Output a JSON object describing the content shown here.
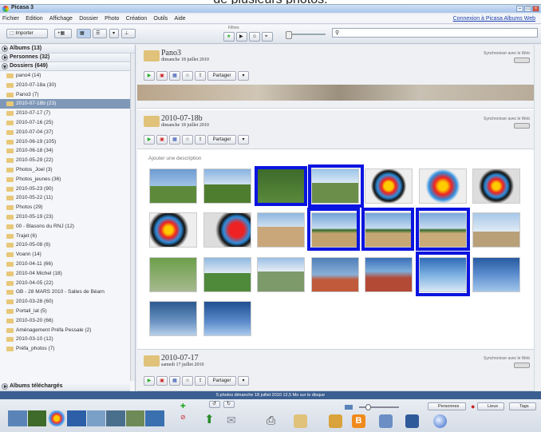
{
  "caption": "de plusieurs photos.",
  "window": {
    "title": "Picasa 3"
  },
  "menu": {
    "items": [
      "Fichier",
      "Edition",
      "Affichage",
      "Dossier",
      "Photo",
      "Création",
      "Outils",
      "Aide"
    ],
    "account_link": "Connexion à Picasa Albums Web"
  },
  "toolbar": {
    "import_label": "Importer",
    "filter_title": "Filtres"
  },
  "sidebar": {
    "albums": "Albums (13)",
    "people": "Personnes (32)",
    "folders": "Dossiers (649)",
    "folder_items": [
      "pano4 (14)",
      "2010-07-18a (30)",
      "Pano3 (7)",
      "2010-07-18b (23)",
      "2010-07-17 (7)",
      "2010-07-16 (25)",
      "2010-07-04 (37)",
      "2010-06-19 (105)",
      "2010-06-18 (34)",
      "2010-05-29 (22)",
      "Photos_Joel (3)",
      "Photos_jeunes (36)",
      "2010-05-23 (90)",
      "2010-05-22 (11)",
      "Photos (29)",
      "2010-05-19 (23)",
      "00 - Blasons du RNJ (12)",
      "Trajet (6)",
      "2010-05-08 (6)",
      "Voann (14)",
      "2010-04-11 (66)",
      "2010-04 Michel (18)",
      "2010-04-05 (22)",
      "GB - 28 MARS 2010 - Salies de Béarn",
      "2010-03-28 (60)",
      "Portail_lat (5)",
      "2010-03-20 (66)",
      "Aménagement Préfa Pessale (2)",
      "2010-03-10 (12)",
      "Préfa_photos (7)"
    ],
    "selected_index": 3,
    "downloaded": "Albums téléchargés"
  },
  "folders": [
    {
      "name": "Pano3",
      "date": "dimanche 18 juillet 2010",
      "sync": "Synchroniser avec le Web",
      "share": "Partager"
    },
    {
      "name": "2010-07-18b",
      "date": "dimanche 18 juillet 2010",
      "sync": "Synchroniser avec le Web",
      "share": "Partager",
      "add_desc": "Ajouter une description"
    },
    {
      "name": "2010-07-17",
      "date": "samedi 17 juillet 2010",
      "sync": "Synchroniser avec le Web",
      "share": "Partager"
    }
  ],
  "status": {
    "text": "5 photos  dimanche 18 juillet 2010  12,5 Mo sur le disque"
  },
  "tray": {
    "people_label": "Personnes",
    "places_label": "Lieux",
    "tags_label": "Tags"
  },
  "colors": {
    "highlight": "#0a14e0",
    "selected_folder": "#7f98b8",
    "status_bar": "#3c5f91"
  }
}
